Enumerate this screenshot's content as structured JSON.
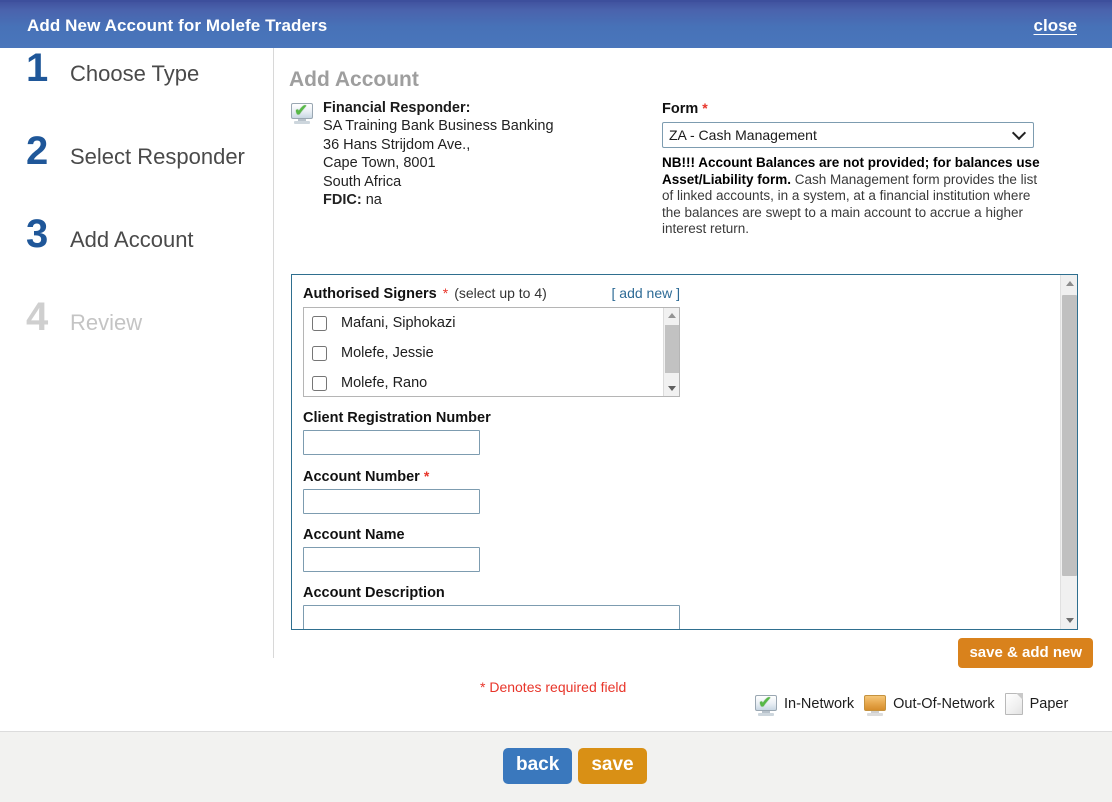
{
  "titlebar": {
    "title": "Add New Account for Molefe Traders",
    "close_label": "close"
  },
  "steps": [
    {
      "num": "1",
      "label": "Choose Type",
      "state": "active"
    },
    {
      "num": "2",
      "label": "Select Responder",
      "state": "active"
    },
    {
      "num": "3",
      "label": "Add Account",
      "state": "active"
    },
    {
      "num": "4",
      "label": "Review",
      "state": "inactive"
    }
  ],
  "content": {
    "page_title": "Add Account",
    "responder": {
      "icon": "in-network-monitor-icon",
      "heading": "Financial Responder:",
      "line1": "SA Training Bank Business Banking",
      "line2": "36 Hans Strijdom Ave.,",
      "line3": "Cape Town, 8001",
      "line4": "South Africa",
      "fdic_label": "FDIC:",
      "fdic_value": "na"
    },
    "form_select": {
      "label": "Form",
      "required_marker": "*",
      "selected": "ZA - Cash Management",
      "options": [
        "ZA - Cash Management"
      ],
      "note_bold": "NB!!! Account Balances are not provided; for balances use Asset/Liability form.",
      "note_rest": " Cash Management form provides the list of linked accounts, in a system, at a financial institution where the balances are swept to a main account to accrue a higher interest return."
    },
    "signers": {
      "label": "Authorised Signers",
      "required_marker": "*",
      "hint": "(select up to 4)",
      "add_new_label": "[ add new ]",
      "items": [
        {
          "name": "Mafani, Siphokazi",
          "checked": false
        },
        {
          "name": "Molefe, Jessie",
          "checked": false
        },
        {
          "name": "Molefe, Rano",
          "checked": false
        }
      ]
    },
    "fields": [
      {
        "label": "Client Registration Number",
        "value": "",
        "required": false,
        "wide": false
      },
      {
        "label": "Account Number",
        "value": "",
        "required": true,
        "wide": false
      },
      {
        "label": "Account Name",
        "value": "",
        "required": false,
        "wide": false
      },
      {
        "label": "Account Description",
        "value": "",
        "required": false,
        "wide": true
      }
    ],
    "save_add_new_label": "save & add new",
    "required_note": "* Denotes required field",
    "legend": [
      {
        "icon": "in-network-monitor-icon",
        "label": "In-Network"
      },
      {
        "icon": "out-of-network-monitor-icon",
        "label": "Out-Of-Network"
      },
      {
        "icon": "paper-document-icon",
        "label": "Paper"
      }
    ]
  },
  "footer": {
    "back_label": "back",
    "save_label": "save"
  },
  "colors": {
    "titlebar_blue": "#4772b8",
    "step_blue": "#1f5799",
    "step_inactive_gray": "#c4c4c4",
    "accent_orange": "#d9821c",
    "save_orange": "#d99015",
    "back_blue": "#3a78bd",
    "required_red": "#e8352a",
    "link_blue": "#2e6b96",
    "panel_border": "#2f6f8f",
    "footer_bg": "#f2f2f0"
  }
}
